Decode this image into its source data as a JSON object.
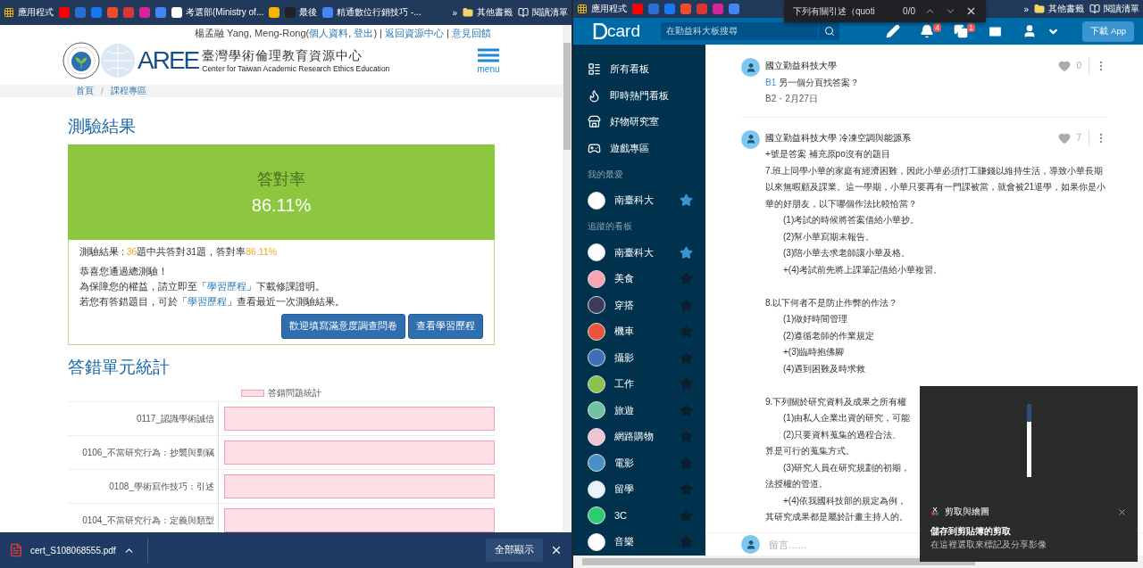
{
  "left_window": {
    "bookmarks": [
      {
        "kind": "apps",
        "label": "應用程式"
      },
      {
        "kind": "icon",
        "color": "#ff0000"
      },
      {
        "kind": "icon",
        "color": "#2a6fd6"
      },
      {
        "kind": "icon",
        "color": "#1877f2"
      },
      {
        "kind": "icon",
        "color": "#ee4d2d"
      },
      {
        "kind": "icon",
        "color": "#d93636"
      },
      {
        "kind": "icon",
        "color": "#d6249f"
      },
      {
        "kind": "icon",
        "color": "#4285f4"
      },
      {
        "kind": "link",
        "label": "考選部(Ministry of...",
        "color": "#ffffff"
      },
      {
        "kind": "icon",
        "color": "#f4b400"
      },
      {
        "kind": "link",
        "label": "最後",
        "color": "#222222"
      },
      {
        "kind": "link",
        "label": "精通數位行銷技巧 -...",
        "color": "#4285f4"
      }
    ],
    "bookmarks_more": "»",
    "other_bookmarks": "其他書籤",
    "reading_list": "閱讀清單",
    "user_bar": [
      {
        "text": "楊孟融 Yang, Meng-Rong(",
        "link": false
      },
      {
        "text": "個人資料",
        "link": true
      },
      {
        "text": ", ",
        "link": false
      },
      {
        "text": "登出",
        "link": true
      },
      {
        "text": ") | ",
        "link": false
      },
      {
        "text": "返回資源中心",
        "link": true
      },
      {
        "text": " | ",
        "link": false
      },
      {
        "text": "意見回饋",
        "link": true
      }
    ],
    "logo": {
      "mark": "AREE",
      "title": "臺灣學術倫理教育資源中心",
      "subtitle": "Center for Taiwan Academic Research Ethics Education"
    },
    "menu_label": "menu",
    "breadcrumb": {
      "items": [
        "首頁",
        "課程專區"
      ],
      "separator": "/"
    },
    "result_title": "測驗結果",
    "score": {
      "label": "答對率",
      "value": "86.11%"
    },
    "result_line": [
      {
        "text": "測驗結果 : ",
        "highlight": false
      },
      {
        "text": "36",
        "highlight": true
      },
      {
        "text": "題中共答對31題，答對率",
        "highlight": false
      },
      {
        "text": "86.11%",
        "highlight": true
      }
    ],
    "messages": [
      [
        {
          "text": "恭喜您通過總測驗！",
          "link": false
        }
      ],
      [
        {
          "text": "為保障您的權益，請立即至「",
          "link": false
        },
        {
          "text": "學習歷程",
          "link": true
        },
        {
          "text": "」下載修課證明。",
          "link": false
        }
      ],
      [
        {
          "text": "若您有答錯題目，可於「",
          "link": false
        },
        {
          "text": "學習歷程",
          "link": true
        },
        {
          "text": "」查看最近一次測驗結果。",
          "link": false
        }
      ]
    ],
    "buttons": [
      "歡迎填寫滿意度調查問卷",
      "查看學習歷程"
    ],
    "stats_title": "答錯單元統計",
    "stats_chart": {
      "legend": "答錯問題統計",
      "categories": [
        "0117_認識學術誠信",
        "0106_不當研究行為：抄襲與剽竊",
        "0108_學術寫作技巧：引述",
        "0104_不當研究行為：定義與類型"
      ]
    },
    "download": {
      "file": "cert_S108068555.pdf",
      "show_all": "全部顯示"
    }
  },
  "right_window": {
    "bookmarks": [
      {
        "kind": "apps",
        "label": "應用程式"
      },
      {
        "kind": "icon",
        "color": "#ff0000"
      },
      {
        "kind": "icon",
        "color": "#2a6fd6"
      },
      {
        "kind": "icon",
        "color": "#1877f2"
      },
      {
        "kind": "icon",
        "color": "#ee4d2d"
      },
      {
        "kind": "icon",
        "color": "#d93636"
      },
      {
        "kind": "icon",
        "color": "#d6249f"
      },
      {
        "kind": "icon",
        "color": "#4285f4"
      }
    ],
    "bookmarks_more": "»",
    "other_bookmarks": "其他書籤",
    "reading_list": "閱讀清單",
    "find_bar": {
      "query": "下列有關引述（quoti",
      "count": "0/0"
    },
    "header": {
      "logo": "card",
      "search_placeholder": "在勤益科大板搜尋",
      "notification_count": "4",
      "card_count": "1",
      "download_button": "下載 App"
    },
    "sidebar": {
      "main": [
        "所有看板",
        "即時熱門看板",
        "好物研究室",
        "遊戲專區"
      ],
      "favorites_label": "我的最愛",
      "favorites": [
        {
          "name": "南臺科大",
          "starred": true,
          "color": "#ffffff"
        }
      ],
      "followed_label": "追蹤的看板",
      "followed": [
        {
          "name": "南臺科大",
          "starred": true,
          "color": "#ffffff"
        },
        {
          "name": "美食",
          "starred": false,
          "color": "#f6a5b3"
        },
        {
          "name": "穿搭",
          "starred": false,
          "color": "#3b3b5c"
        },
        {
          "name": "機車",
          "starred": false,
          "color": "#e8533b"
        },
        {
          "name": "攝影",
          "starred": false,
          "color": "#3d6fb6"
        },
        {
          "name": "工作",
          "starred": false,
          "color": "#8bc34a"
        },
        {
          "name": "旅遊",
          "starred": false,
          "color": "#6fc3a0"
        },
        {
          "name": "網路購物",
          "starred": false,
          "color": "#f3c3d6"
        },
        {
          "name": "電影",
          "starred": false,
          "color": "#4a90c8"
        },
        {
          "name": "留學",
          "starred": false,
          "color": "#e8f3fb"
        },
        {
          "name": "3C",
          "starred": false,
          "color": "#2ecc71"
        },
        {
          "name": "音樂",
          "starred": false,
          "color": "#ffffff"
        }
      ]
    },
    "comments": [
      {
        "author": "國立勤益科技大學",
        "likes": "0",
        "reply_to": "B1",
        "lines": [
          {
            "kind": "text",
            "text": "另一個分頁找答案？"
          }
        ],
        "meta": "B2・2月27日"
      },
      {
        "author": "國立勤益科技大學 冷凍空調與能源系",
        "likes": "7",
        "lines": [
          {
            "kind": "text",
            "text": "+號是答案 補充原po沒有的題目"
          },
          {
            "kind": "text",
            "text": "7.班上同學小華的家庭有經濟困難，因此小華必須打工賺錢以維持生活，導致小華長期以來無暇顧及課業。這一學期，小華只要再有一門課被當，就會被21退學，如果你是小華的好朋友，以下哪個作法比較恰當？"
          },
          {
            "kind": "option",
            "text": "(1)考試的時候將答案借給小華抄。"
          },
          {
            "kind": "option",
            "text": "(2)幫小華寫期末報告。"
          },
          {
            "kind": "option",
            "text": "(3)陪小華去求老師讓小華及格。"
          },
          {
            "kind": "option",
            "text": "+(4)考試前先將上課筆記借給小華複習。"
          },
          {
            "kind": "gap"
          },
          {
            "kind": "text",
            "text": "8.以下何者不是防止作弊的作法？"
          },
          {
            "kind": "option",
            "text": "(1)做好時間管理"
          },
          {
            "kind": "option",
            "text": "(2)遵循老師的作業規定"
          },
          {
            "kind": "option",
            "text": "+(3)臨時抱佛腳"
          },
          {
            "kind": "option",
            "text": "(4)遇到困難及時求救"
          },
          {
            "kind": "gap"
          },
          {
            "kind": "text",
            "text": "9.下列關於研究資料及成果之所有權"
          },
          {
            "kind": "option",
            "text": "(1)由私人企業出資的研究，可能"
          },
          {
            "kind": "option",
            "text": "(2)只要資料蒐集的過程合法、"
          },
          {
            "kind": "text",
            "text": "算是可行的蒐集方式。"
          },
          {
            "kind": "option",
            "text": "(3)研究人員在研究規劃的初期，"
          },
          {
            "kind": "text",
            "text": "法授權的管道。"
          },
          {
            "kind": "option",
            "text": "+(4)依我國科技部的規定為例，"
          },
          {
            "kind": "text",
            "text": "其研究成果都是屬於計畫主持人的。"
          }
        ]
      }
    ],
    "comment_placeholder": "留言……",
    "snip_toast": {
      "app": "剪取與繪圖",
      "title": "儲存到剪貼簿的剪取",
      "body": "在這裡選取來標記及分享影像"
    }
  }
}
